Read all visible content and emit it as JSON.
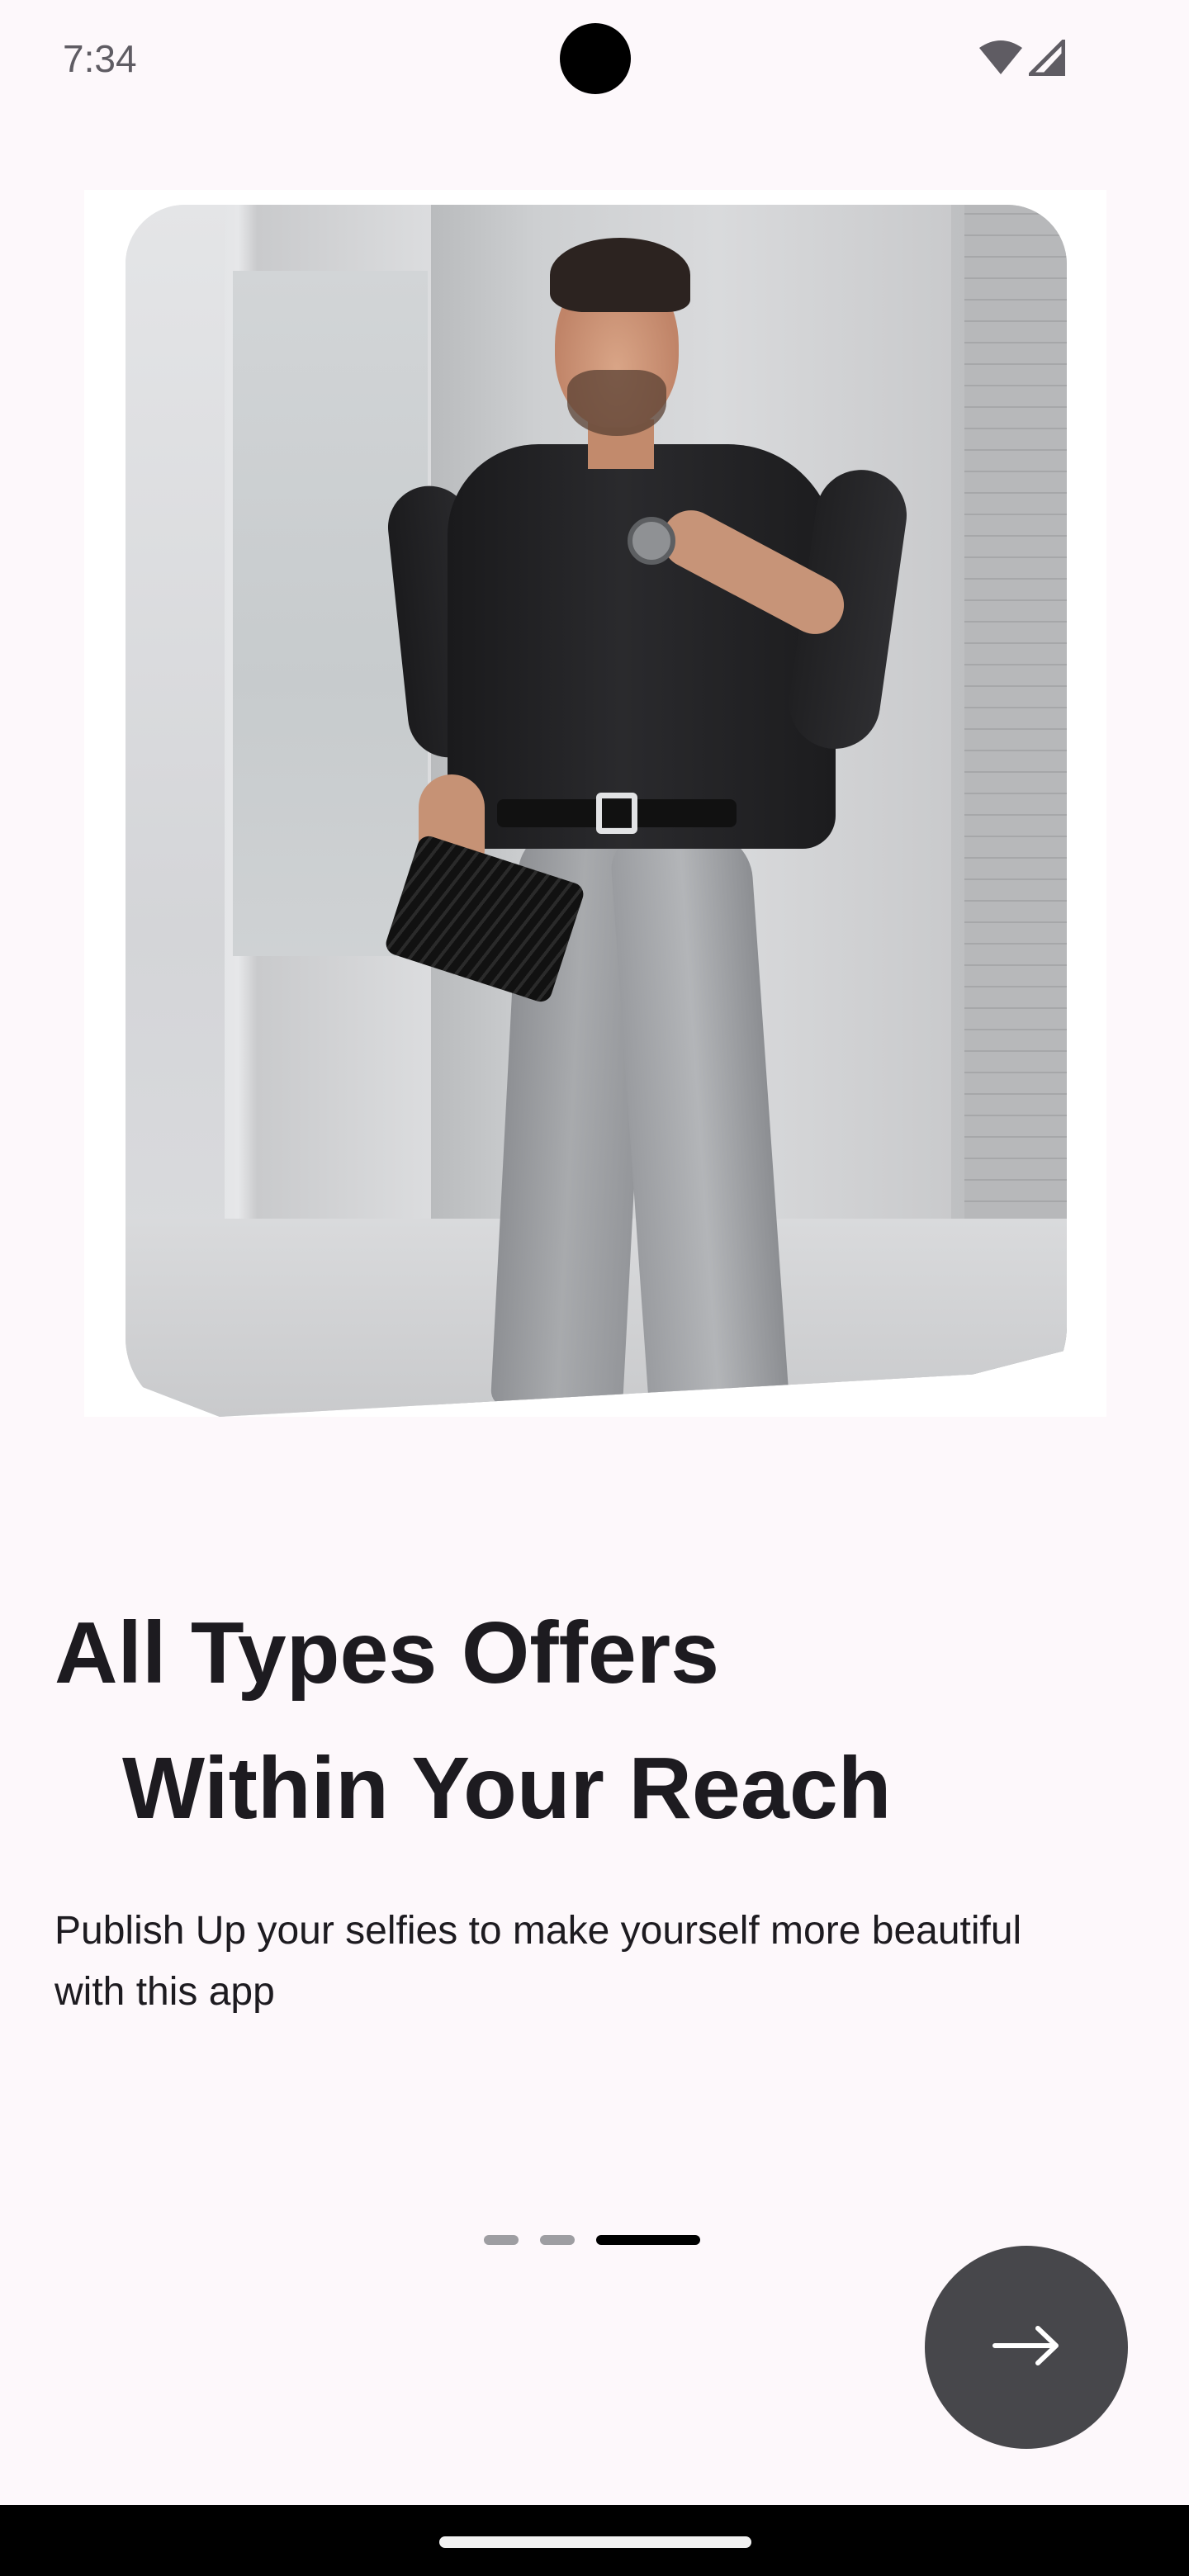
{
  "status_bar": {
    "time": "7:34",
    "icons": [
      "wifi-icon",
      "cellular-signal-icon"
    ]
  },
  "hero": {
    "image_description_name": "model-photo"
  },
  "onboarding": {
    "headline_line1": "All Types Offers",
    "headline_line2": "Within Your Reach",
    "description": "Publish Up your selfies to make yourself more beautiful with this app",
    "page_indicator": {
      "total": 3,
      "current": 3
    },
    "next_button_icon": "arrow-right-icon"
  },
  "colors": {
    "background": "#fdf8fb",
    "fab": "#47474b",
    "indicator_active": "#000000",
    "indicator_inactive": "#9e9ea2",
    "text": "#1d1b20"
  }
}
